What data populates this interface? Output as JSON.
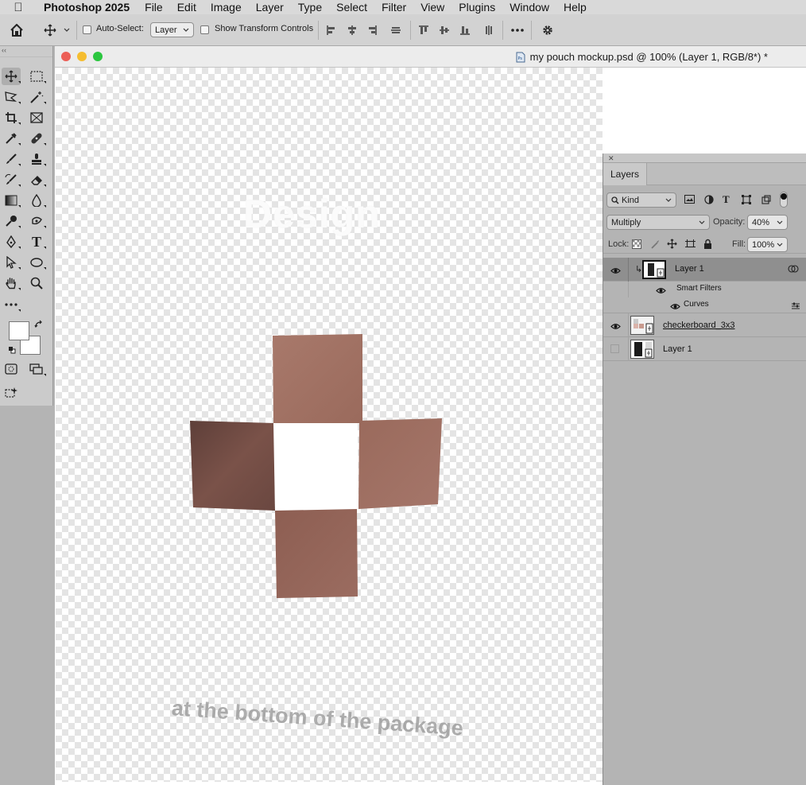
{
  "menubar": {
    "app_name": "Photoshop 2025",
    "items": [
      "File",
      "Edit",
      "Image",
      "Layer",
      "Type",
      "Select",
      "Filter",
      "View",
      "Plugins",
      "Window",
      "Help"
    ]
  },
  "options_bar": {
    "auto_select_label": "Auto-Select:",
    "auto_select_value": "Layer",
    "show_transform_label": "Show Transform Controls"
  },
  "document": {
    "title": "my pouch mockup.psd @ 100% (Layer 1, RGB/8*) *",
    "canvas_text_top": "Design",
    "canvas_text_bottom": "at the bottom of the package"
  },
  "layers_panel": {
    "tab_label": "Layers",
    "filter_kind": "Kind",
    "blend_mode": "Multiply",
    "opacity_label": "Opacity:",
    "opacity_value": "40%",
    "lock_label": "Lock:",
    "fill_label": "Fill:",
    "fill_value": "100%",
    "layers": [
      {
        "name": "Layer 1",
        "visible": true,
        "selected": true
      },
      {
        "name": "Smart Filters",
        "visible": true
      },
      {
        "name": "Curves",
        "visible": true
      },
      {
        "name": "checkerboard_3x3",
        "visible": true
      },
      {
        "name": "Layer 1",
        "visible": false
      }
    ]
  },
  "colors": {
    "patch_light": "#9d6a5c",
    "patch_dark": "#6e4a42",
    "traffic_red": "#ec5f57",
    "traffic_yellow": "#f5bd30",
    "traffic_green": "#2bc63f"
  }
}
